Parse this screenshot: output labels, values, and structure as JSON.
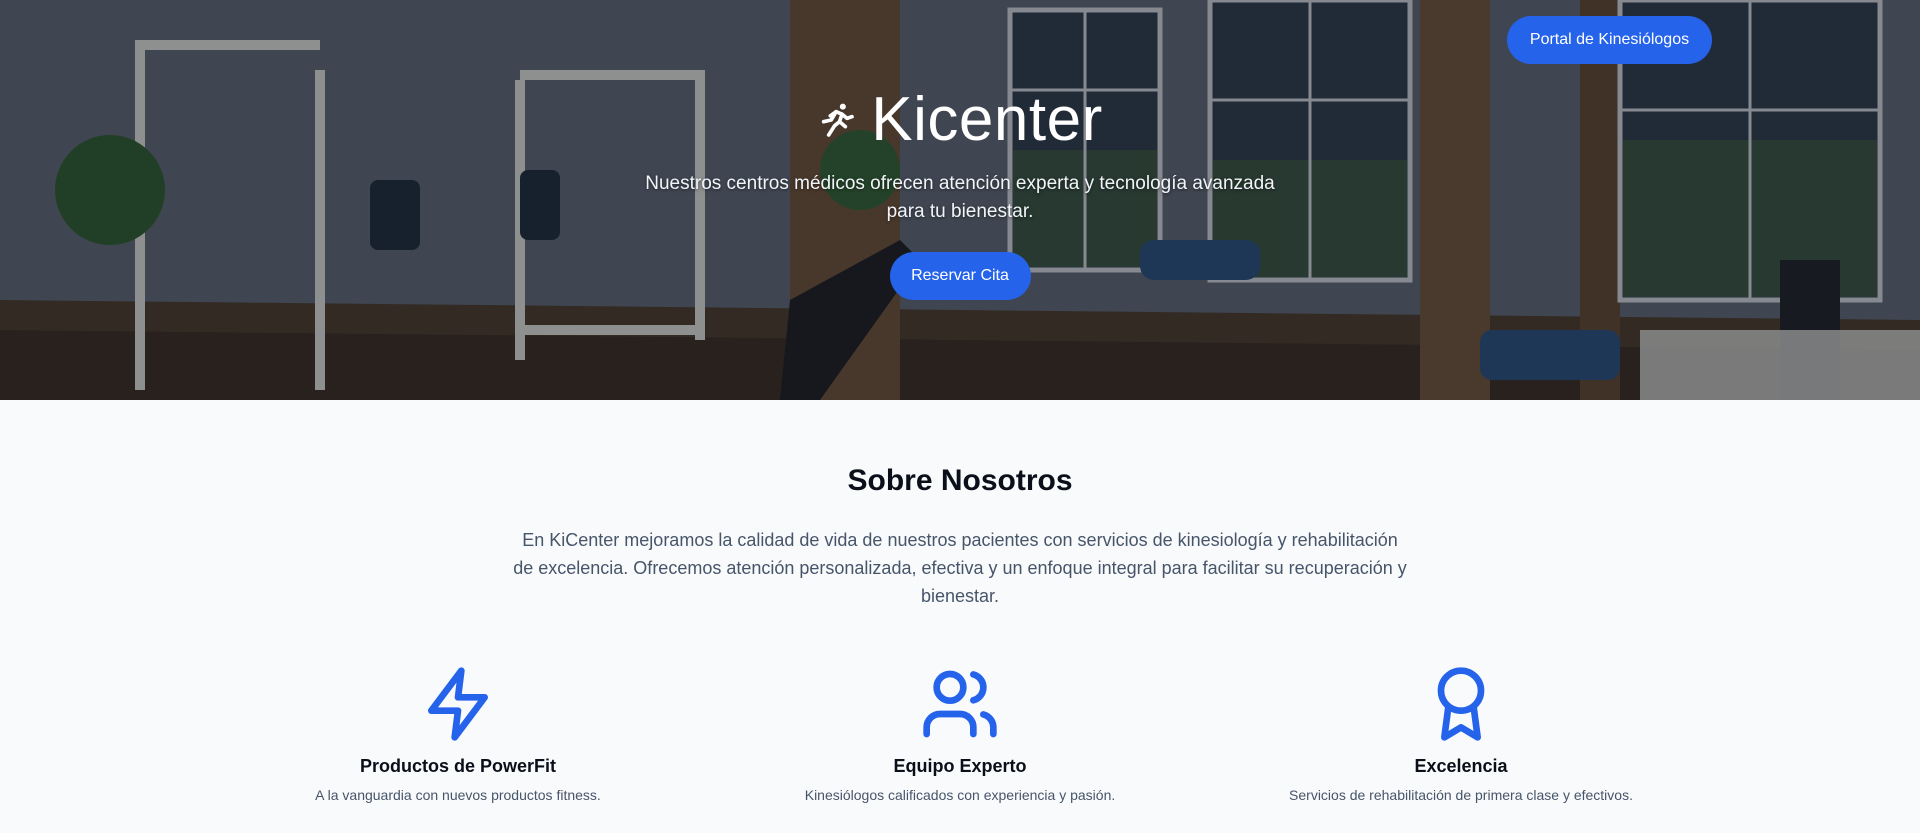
{
  "header": {
    "portal_button": "Portal de Kinesiólogos"
  },
  "hero": {
    "brand_name": "Kicenter",
    "brand_icon": "running-person-icon",
    "tagline": "Nuestros centros médicos ofrecen atención experta y tecnología avanzada para tu bienestar.",
    "cta_label": "Reservar Cita"
  },
  "about": {
    "title": "Sobre Nosotros",
    "text": "En KiCenter mejoramos la calidad de vida de nuestros pacientes con servicios de kinesiología y rehabilitación de excelencia. Ofrecemos atención personalizada, efectiva y un enfoque integral para facilitar su recuperación y bienestar.",
    "features": [
      {
        "icon": "lightning-bolt-icon",
        "title": "Productos de PowerFit",
        "description": "A la vanguardia con nuevos productos fitness."
      },
      {
        "icon": "users-icon",
        "title": "Equipo Experto",
        "description": "Kinesiólogos calificados con experiencia y pasión."
      },
      {
        "icon": "award-ribbon-icon",
        "title": "Excelencia",
        "description": "Servicios de rehabilitación de primera clase y efectivos."
      }
    ]
  },
  "colors": {
    "accent": "#2563eb",
    "page_background": "#f8fafc",
    "heading": "#0b0f19",
    "body_text": "#475569"
  }
}
